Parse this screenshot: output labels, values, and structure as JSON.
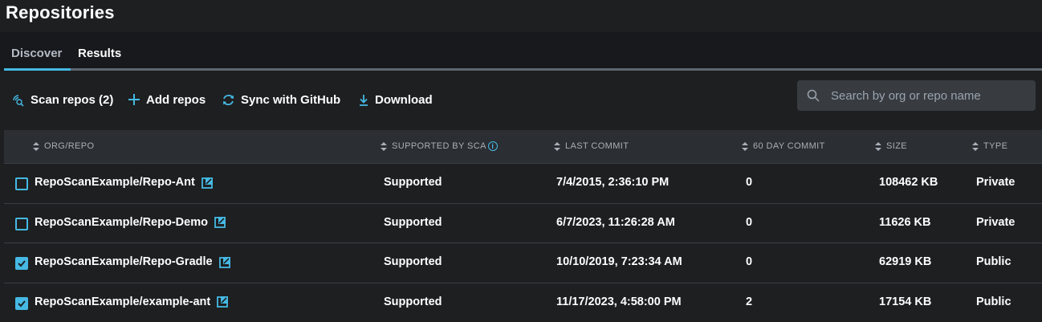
{
  "page": {
    "title": "Repositories"
  },
  "tabs": [
    {
      "label": "Discover",
      "active": true
    },
    {
      "label": "Results",
      "active": false
    }
  ],
  "toolbar": {
    "scan_label": "Scan repos (2)",
    "add_label": "Add repos",
    "sync_label": "Sync with GitHub",
    "download_label": "Download"
  },
  "search": {
    "placeholder": "Search by org or repo name",
    "value": ""
  },
  "table": {
    "columns": {
      "org_repo": "ORG/REPO",
      "supported": "SUPPORTED BY SCA",
      "last_commit": "LAST COMMIT",
      "day60": "60 DAY COMMIT",
      "size": "SIZE",
      "type": "TYPE"
    },
    "rows": [
      {
        "checked": false,
        "repo": "RepoScanExample/Repo-Ant",
        "supported": "Supported",
        "last_commit": "7/4/2015, 2:36:10 PM",
        "day60": "0",
        "size": "108462 KB",
        "type": "Private"
      },
      {
        "checked": false,
        "repo": "RepoScanExample/Repo-Demo",
        "supported": "Supported",
        "last_commit": "6/7/2023, 11:26:28 AM",
        "day60": "0",
        "size": "11626 KB",
        "type": "Private"
      },
      {
        "checked": true,
        "repo": "RepoScanExample/Repo-Gradle",
        "supported": "Supported",
        "last_commit": "10/10/2019, 7:23:34 AM",
        "day60": "0",
        "size": "62919 KB",
        "type": "Public"
      },
      {
        "checked": true,
        "repo": "RepoScanExample/example-ant",
        "supported": "Supported",
        "last_commit": "11/17/2023, 4:58:00 PM",
        "day60": "2",
        "size": "17154 KB",
        "type": "Public"
      }
    ]
  },
  "colors": {
    "accent": "#45b9e3",
    "background": "#1e1f21",
    "header_band": "#17191c",
    "table_header": "#2b2e32"
  },
  "icons": [
    "scan-icon",
    "plus-icon",
    "sync-icon",
    "download-icon",
    "search-icon",
    "info-icon",
    "external-link-icon",
    "checkbox-checked-icon"
  ]
}
